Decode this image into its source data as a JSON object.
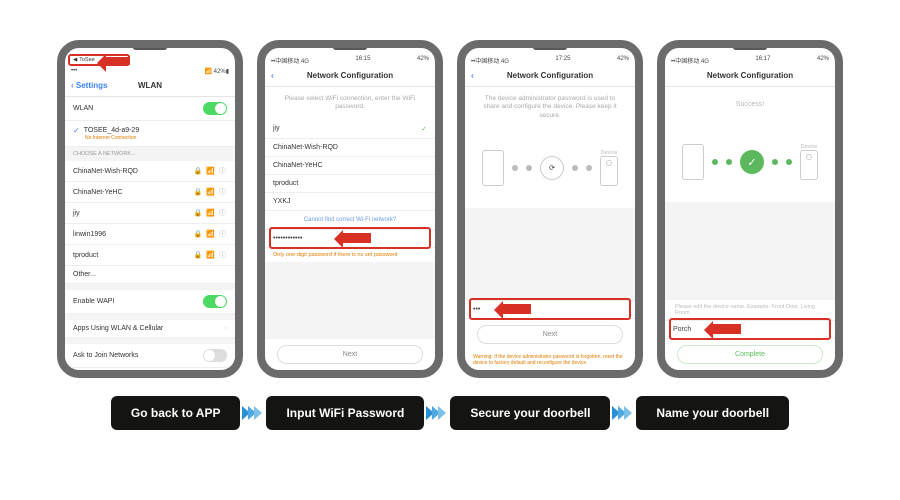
{
  "status": {
    "carrier_cn": "••中国移动 4G",
    "time1": "16:15",
    "time2": "17:25",
    "time3": "16:17",
    "batt": "42%"
  },
  "phone1": {
    "back": "Settings",
    "title": "WLAN",
    "toggle": "WLAN",
    "connected": {
      "name": "TOSEE_4d-a9-29",
      "sub": "No Internet Connection"
    },
    "choose": "CHOOSE A NETWORK...",
    "nets": [
      "ChinaNet-Wish-RQD",
      "ChinaNet-YeHC",
      "jiy",
      "linwin1996",
      "tproduct",
      "Other..."
    ],
    "wapi": "Enable WAPI",
    "apps": "Apps Using WLAN & Cellular",
    "ask": "Ask to Join Networks",
    "pill_tosee": "ToSee"
  },
  "phone2": {
    "title": "Network Configuration",
    "instr": "Please select WiFi connection, enter the WiFi password.",
    "sel": "jiy",
    "nets": [
      "ChinaNet-Wish-RQD",
      "ChinaNet-YeHC",
      "tproduct",
      "YXKJ"
    ],
    "link": "Cannot find correct Wi-Fi network?",
    "pwd": "••••••••••••",
    "warn": "Only one-digit password if there is no set password",
    "next": "Next"
  },
  "phone3": {
    "title": "Network Configuration",
    "instr": "The device administrator password is used to share and configure the device. Please keep it secure.",
    "device": "Device",
    "pwd": "•••",
    "next": "Next",
    "warn": "Warning: If the device administrator password is forgotten, reset the device to factory default and reconfigure the device."
  },
  "phone4": {
    "title": "Network Configuration",
    "succ": "Success!",
    "device": "Device",
    "hint": "Please edit the device name. Example: Front Door, Living Room",
    "val": "Porch",
    "complete": "Complete"
  },
  "captions": [
    "Go back to APP",
    "Input WiFi Password",
    "Secure your doorbell",
    "Name your doorbell"
  ]
}
